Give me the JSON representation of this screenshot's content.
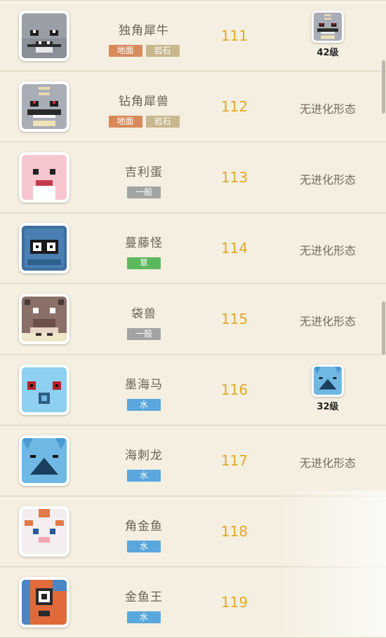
{
  "type_colors": {
    "地面": "#d98a5c",
    "岩石": "#c9b88e",
    "一般": "#a3a3a3",
    "草": "#5cb85c",
    "水": "#5aa7de"
  },
  "no_evolution_text": "无进化形态",
  "rows": [
    {
      "name": "独角犀牛",
      "types": [
        "地面",
        "岩石"
      ],
      "number": "111",
      "icon": "rhyhorn-icon",
      "evolution": {
        "icon": "rhydon-icon",
        "level": "42级"
      }
    },
    {
      "name": "钻角犀兽",
      "types": [
        "地面",
        "岩石"
      ],
      "number": "112",
      "icon": "rhydon-icon",
      "evolution": null
    },
    {
      "name": "吉利蛋",
      "types": [
        "一般"
      ],
      "number": "113",
      "icon": "chansey-icon",
      "evolution": null
    },
    {
      "name": "蔓藤怪",
      "types": [
        "草"
      ],
      "number": "114",
      "icon": "tangela-icon",
      "evolution": null
    },
    {
      "name": "袋兽",
      "types": [
        "一般"
      ],
      "number": "115",
      "icon": "kangaskhan-icon",
      "evolution": null
    },
    {
      "name": "墨海马",
      "types": [
        "水"
      ],
      "number": "116",
      "icon": "horsea-icon",
      "evolution": {
        "icon": "seadra-icon",
        "level": "32级"
      }
    },
    {
      "name": "海刺龙",
      "types": [
        "水"
      ],
      "number": "117",
      "icon": "seadra-icon",
      "evolution": null
    },
    {
      "name": "角金鱼",
      "types": [
        "水"
      ],
      "number": "118",
      "icon": "goldeen-icon",
      "evolution": null
    },
    {
      "name": "金鱼王",
      "types": [
        "水"
      ],
      "number": "119",
      "icon": "seaking-icon",
      "evolution": null
    }
  ]
}
